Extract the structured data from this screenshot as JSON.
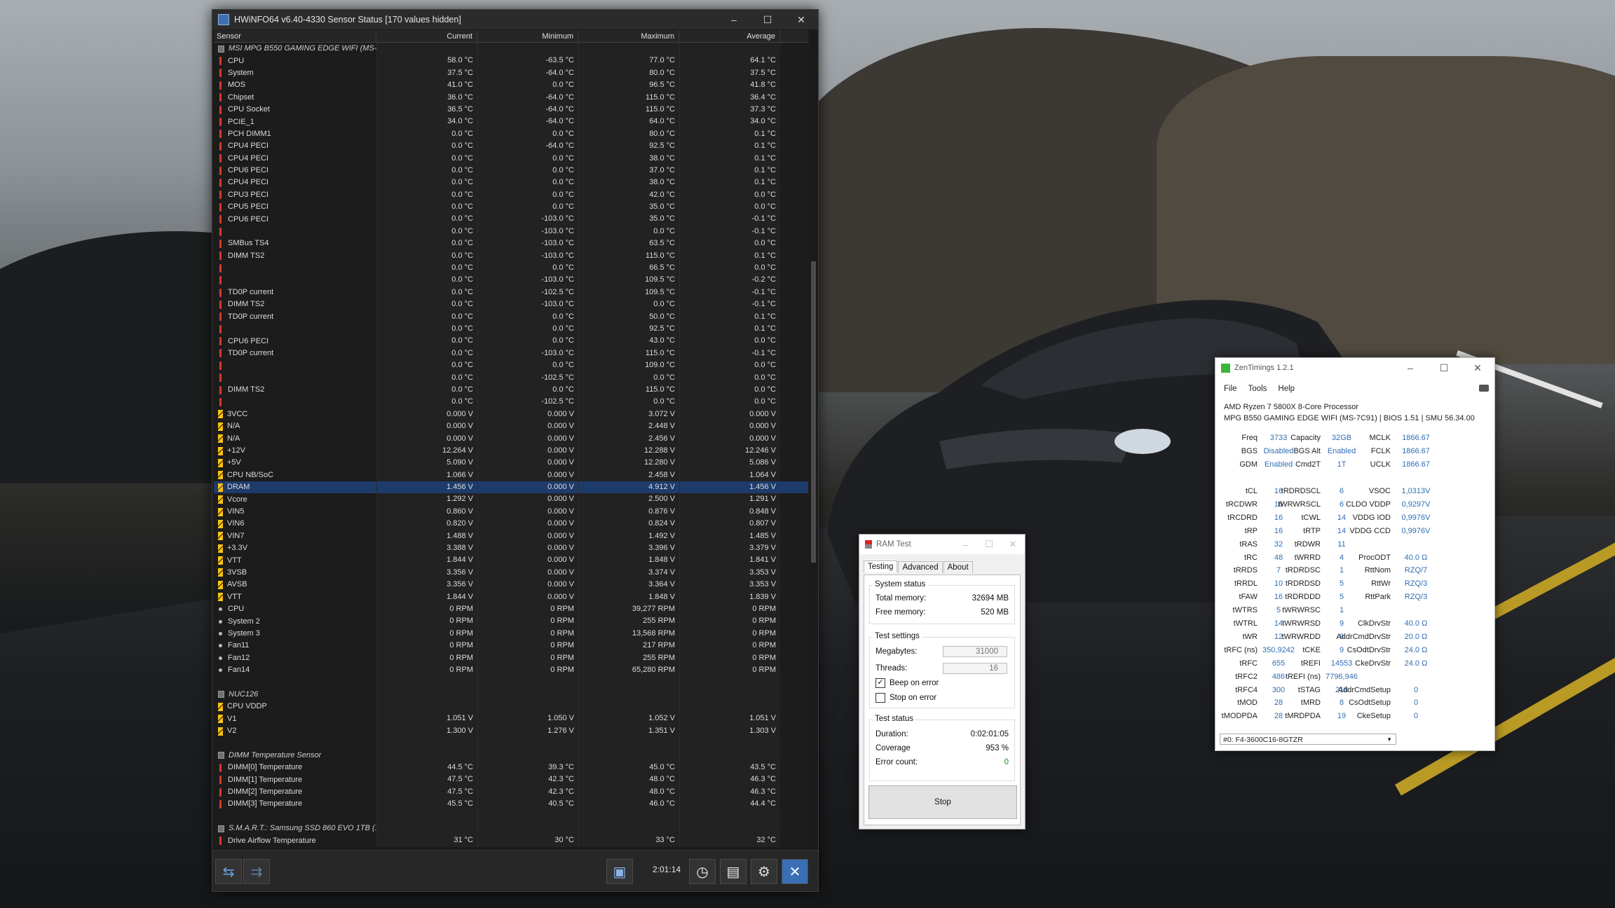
{
  "hwinfo": {
    "title": "HWiNFO64 v6.40-4330 Sensor Status [170 values hidden]",
    "columns": [
      "Sensor",
      "Current",
      "Minimum",
      "Maximum",
      "Average"
    ],
    "rows": [
      {
        "kind": "group",
        "name": "MSI MPG B550 GAMING EDGE WIFI (MS-...",
        "cur": "",
        "min": "",
        "max": "",
        "avg": ""
      },
      {
        "kind": "temp",
        "name": "CPU",
        "cur": "58.0 °C",
        "min": "-63.5 °C",
        "max": "77.0 °C",
        "avg": "64.1 °C"
      },
      {
        "kind": "temp",
        "name": "System",
        "cur": "37.5 °C",
        "min": "-64.0 °C",
        "max": "80.0 °C",
        "avg": "37.5 °C"
      },
      {
        "kind": "temp",
        "name": "MOS",
        "cur": "41.0 °C",
        "min": "0.0 °C",
        "max": "96.5 °C",
        "avg": "41.8 °C"
      },
      {
        "kind": "temp",
        "name": "Chipset",
        "cur": "36.0 °C",
        "min": "-64.0 °C",
        "max": "115.0 °C",
        "avg": "36.4 °C"
      },
      {
        "kind": "temp",
        "name": "CPU Socket",
        "cur": "36.5 °C",
        "min": "-64.0 °C",
        "max": "115.0 °C",
        "avg": "37.3 °C"
      },
      {
        "kind": "temp",
        "name": "PCIE_1",
        "cur": "34.0 °C",
        "min": "-64.0 °C",
        "max": "64.0 °C",
        "avg": "34.0 °C"
      },
      {
        "kind": "temp",
        "name": "PCH DIMM1",
        "cur": "0.0 °C",
        "min": "0.0 °C",
        "max": "80.0 °C",
        "avg": "0.1 °C"
      },
      {
        "kind": "temp",
        "name": "CPU4 PECI",
        "cur": "0.0 °C",
        "min": "-64.0 °C",
        "max": "92.5 °C",
        "avg": "0.1 °C"
      },
      {
        "kind": "temp",
        "name": "CPU4 PECI",
        "cur": "0.0 °C",
        "min": "0.0 °C",
        "max": "38.0 °C",
        "avg": "0.1 °C"
      },
      {
        "kind": "temp",
        "name": "CPU6 PECI",
        "cur": "0.0 °C",
        "min": "0.0 °C",
        "max": "37.0 °C",
        "avg": "0.1 °C"
      },
      {
        "kind": "temp",
        "name": "CPU4 PECI",
        "cur": "0.0 °C",
        "min": "0.0 °C",
        "max": "38.0 °C",
        "avg": "0.1 °C"
      },
      {
        "kind": "temp",
        "name": "CPU3 PECI",
        "cur": "0.0 °C",
        "min": "0.0 °C",
        "max": "42.0 °C",
        "avg": "0.0 °C"
      },
      {
        "kind": "temp",
        "name": "CPU5 PECI",
        "cur": "0.0 °C",
        "min": "0.0 °C",
        "max": "35.0 °C",
        "avg": "0.0 °C"
      },
      {
        "kind": "temp",
        "name": "CPU6 PECI",
        "cur": "0.0 °C",
        "min": "-103.0 °C",
        "max": "35.0 °C",
        "avg": "-0.1 °C"
      },
      {
        "kind": "temp",
        "name": "",
        "cur": "0.0 °C",
        "min": "-103.0 °C",
        "max": "0.0 °C",
        "avg": "-0.1 °C"
      },
      {
        "kind": "temp",
        "name": "SMBus TS4",
        "cur": "0.0 °C",
        "min": "-103.0 °C",
        "max": "63.5 °C",
        "avg": "0.0 °C"
      },
      {
        "kind": "temp",
        "name": "DIMM TS2",
        "cur": "0.0 °C",
        "min": "-103.0 °C",
        "max": "115.0 °C",
        "avg": "0.1 °C"
      },
      {
        "kind": "temp",
        "name": "",
        "cur": "0.0 °C",
        "min": "0.0 °C",
        "max": "66.5 °C",
        "avg": "0.0 °C"
      },
      {
        "kind": "temp",
        "name": "",
        "cur": "0.0 °C",
        "min": "-103.0 °C",
        "max": "109.5 °C",
        "avg": "-0.2 °C"
      },
      {
        "kind": "temp",
        "name": "TD0P current",
        "cur": "0.0 °C",
        "min": "-102.5 °C",
        "max": "109.5 °C",
        "avg": "-0.1 °C"
      },
      {
        "kind": "temp",
        "name": "DIMM TS2",
        "cur": "0.0 °C",
        "min": "-103.0 °C",
        "max": "0.0 °C",
        "avg": "-0.1 °C"
      },
      {
        "kind": "temp",
        "name": "TD0P current",
        "cur": "0.0 °C",
        "min": "0.0 °C",
        "max": "50.0 °C",
        "avg": "0.1 °C"
      },
      {
        "kind": "temp",
        "name": "",
        "cur": "0.0 °C",
        "min": "0.0 °C",
        "max": "92.5 °C",
        "avg": "0.1 °C"
      },
      {
        "kind": "temp",
        "name": "CPU6 PECI",
        "cur": "0.0 °C",
        "min": "0.0 °C",
        "max": "43.0 °C",
        "avg": "0.0 °C"
      },
      {
        "kind": "temp",
        "name": "TD0P current",
        "cur": "0.0 °C",
        "min": "-103.0 °C",
        "max": "115.0 °C",
        "avg": "-0.1 °C"
      },
      {
        "kind": "temp",
        "name": "",
        "cur": "0.0 °C",
        "min": "0.0 °C",
        "max": "109.0 °C",
        "avg": "0.0 °C"
      },
      {
        "kind": "temp",
        "name": "",
        "cur": "0.0 °C",
        "min": "-102.5 °C",
        "max": "0.0 °C",
        "avg": "0.0 °C"
      },
      {
        "kind": "temp",
        "name": "DIMM TS2",
        "cur": "0.0 °C",
        "min": "0.0 °C",
        "max": "115.0 °C",
        "avg": "0.0 °C"
      },
      {
        "kind": "temp",
        "name": "",
        "cur": "0.0 °C",
        "min": "-102.5 °C",
        "max": "0.0 °C",
        "avg": "0.0 °C"
      },
      {
        "kind": "volt",
        "name": "3VCC",
        "cur": "0.000 V",
        "min": "0.000 V",
        "max": "3.072 V",
        "avg": "0.000 V"
      },
      {
        "kind": "volt",
        "name": "N/A",
        "cur": "0.000 V",
        "min": "0.000 V",
        "max": "2.448 V",
        "avg": "0.000 V"
      },
      {
        "kind": "volt",
        "name": "N/A",
        "cur": "0.000 V",
        "min": "0.000 V",
        "max": "2.456 V",
        "avg": "0.000 V"
      },
      {
        "kind": "volt",
        "name": "+12V",
        "cur": "12.264 V",
        "min": "0.000 V",
        "max": "12.288 V",
        "avg": "12.246 V"
      },
      {
        "kind": "volt",
        "name": "+5V",
        "cur": "5.090 V",
        "min": "0.000 V",
        "max": "12.280 V",
        "avg": "5.086 V"
      },
      {
        "kind": "volt",
        "name": "CPU NB/SoC",
        "cur": "1.066 V",
        "min": "0.000 V",
        "max": "2.458 V",
        "avg": "1.064 V"
      },
      {
        "kind": "volt",
        "name": "DRAM",
        "cur": "1.456 V",
        "min": "0.000 V",
        "max": "4.912 V",
        "avg": "1.456 V",
        "selected": true
      },
      {
        "kind": "volt",
        "name": "Vcore",
        "cur": "1.292 V",
        "min": "0.000 V",
        "max": "2.500 V",
        "avg": "1.291 V"
      },
      {
        "kind": "volt",
        "name": "VIN5",
        "cur": "0.860 V",
        "min": "0.000 V",
        "max": "0.876 V",
        "avg": "0.848 V"
      },
      {
        "kind": "volt",
        "name": "VIN6",
        "cur": "0.820 V",
        "min": "0.000 V",
        "max": "0.824 V",
        "avg": "0.807 V"
      },
      {
        "kind": "volt",
        "name": "VIN7",
        "cur": "1.488 V",
        "min": "0.000 V",
        "max": "1.492 V",
        "avg": "1.485 V"
      },
      {
        "kind": "volt",
        "name": "+3.3V",
        "cur": "3.388 V",
        "min": "0.000 V",
        "max": "3.396 V",
        "avg": "3.379 V"
      },
      {
        "kind": "volt",
        "name": "VTT",
        "cur": "1.844 V",
        "min": "0.000 V",
        "max": "1.848 V",
        "avg": "1.841 V"
      },
      {
        "kind": "volt",
        "name": "3VSB",
        "cur": "3.356 V",
        "min": "0.000 V",
        "max": "3.374 V",
        "avg": "3.353 V"
      },
      {
        "kind": "volt",
        "name": "AVSB",
        "cur": "3.356 V",
        "min": "0.000 V",
        "max": "3.364 V",
        "avg": "3.353 V"
      },
      {
        "kind": "volt",
        "name": "VTT",
        "cur": "1.844 V",
        "min": "0.000 V",
        "max": "1.848 V",
        "avg": "1.839 V"
      },
      {
        "kind": "fan",
        "name": "CPU",
        "cur": "0 RPM",
        "min": "0 RPM",
        "max": "39,277 RPM",
        "avg": "0 RPM"
      },
      {
        "kind": "fan",
        "name": "System 2",
        "cur": "0 RPM",
        "min": "0 RPM",
        "max": "255 RPM",
        "avg": "0 RPM"
      },
      {
        "kind": "fan",
        "name": "System 3",
        "cur": "0 RPM",
        "min": "0 RPM",
        "max": "13,568 RPM",
        "avg": "0 RPM"
      },
      {
        "kind": "fan",
        "name": "Fan11",
        "cur": "0 RPM",
        "min": "0 RPM",
        "max": "217 RPM",
        "avg": "0 RPM"
      },
      {
        "kind": "fan",
        "name": "Fan12",
        "cur": "0 RPM",
        "min": "0 RPM",
        "max": "255 RPM",
        "avg": "0 RPM"
      },
      {
        "kind": "fan",
        "name": "Fan14",
        "cur": "0 RPM",
        "min": "0 RPM",
        "max": "65,280 RPM",
        "avg": "0 RPM"
      },
      {
        "kind": "blank",
        "name": "",
        "cur": "",
        "min": "",
        "max": "",
        "avg": ""
      },
      {
        "kind": "group",
        "name": "NUC126",
        "cur": "",
        "min": "",
        "max": "",
        "avg": ""
      },
      {
        "kind": "volt",
        "name": "CPU VDDP",
        "cur": "",
        "min": "",
        "max": "",
        "avg": ""
      },
      {
        "kind": "volt",
        "name": "V1",
        "cur": "1.051 V",
        "min": "1.050 V",
        "max": "1.052 V",
        "avg": "1.051 V"
      },
      {
        "kind": "volt",
        "name": "V2",
        "cur": "1.300 V",
        "min": "1.276 V",
        "max": "1.351 V",
        "avg": "1.303 V"
      },
      {
        "kind": "blank",
        "name": "",
        "cur": "",
        "min": "",
        "max": "",
        "avg": ""
      },
      {
        "kind": "group",
        "name": "DIMM Temperature Sensor",
        "cur": "",
        "min": "",
        "max": "",
        "avg": ""
      },
      {
        "kind": "temp",
        "name": "DIMM[0] Temperature",
        "cur": "44.5 °C",
        "min": "39.3 °C",
        "max": "45.0 °C",
        "avg": "43.5 °C"
      },
      {
        "kind": "temp",
        "name": "DIMM[1] Temperature",
        "cur": "47.5 °C",
        "min": "42.3 °C",
        "max": "48.0 °C",
        "avg": "46.3 °C"
      },
      {
        "kind": "temp",
        "name": "DIMM[2] Temperature",
        "cur": "47.5 °C",
        "min": "42.3 °C",
        "max": "48.0 °C",
        "avg": "46.3 °C"
      },
      {
        "kind": "temp",
        "name": "DIMM[3] Temperature",
        "cur": "45.5 °C",
        "min": "40.5 °C",
        "max": "46.0 °C",
        "avg": "44.4 °C"
      },
      {
        "kind": "blank",
        "name": "",
        "cur": "",
        "min": "",
        "max": "",
        "avg": ""
      },
      {
        "kind": "group",
        "name": "S.M.A.R.T.: Samsung SSD 860 EVO 1TB (...",
        "cur": "",
        "min": "",
        "max": "",
        "avg": ""
      },
      {
        "kind": "temp",
        "name": "Drive Airflow Temperature",
        "cur": "31 °C",
        "min": "30 °C",
        "max": "33 °C",
        "avg": "32 °C"
      }
    ],
    "toolbar": {
      "timer": "2:01:14"
    }
  },
  "ramtest": {
    "title": "RAM Test",
    "tabs": [
      "Testing",
      "Advanced",
      "About"
    ],
    "system_status_label": "System status",
    "total_memory_label": "Total memory:",
    "total_memory": "32694 MB",
    "free_memory_label": "Free memory:",
    "free_memory": "520 MB",
    "test_settings_label": "Test settings",
    "megabytes_label": "Megabytes:",
    "megabytes": "31000",
    "threads_label": "Threads:",
    "threads": "16",
    "beep_on_error": "Beep on error",
    "stop_on_error": "Stop on error",
    "test_status_label": "Test status",
    "duration_label": "Duration:",
    "duration": "0:02:01:05",
    "coverage_label": "Coverage",
    "coverage": "953 %",
    "error_count_label": "Error count:",
    "error_count": "0",
    "stop_label": "Stop"
  },
  "zentimings": {
    "title": "ZenTimings 1.2.1",
    "menu": [
      "File",
      "Tools",
      "Help"
    ],
    "cpu": "AMD Ryzen 7 5800X 8-Core Processor",
    "board": "MPG B550 GAMING EDGE WIFI (MS-7C91) | BIOS 1.51 | SMU 56.34.00",
    "top": [
      [
        "Freq",
        "3733",
        "Capacity",
        "32GB",
        "MCLK",
        "1866.67"
      ],
      [
        "BGS",
        "Disabled",
        "BGS Alt",
        "Enabled",
        "FCLK",
        "1866.67"
      ],
      [
        "GDM",
        "Enabled",
        "Cmd2T",
        "1T",
        "UCLK",
        "1866.67"
      ]
    ],
    "timings": [
      [
        "tCL",
        "16",
        "tRDRDSCL",
        "6",
        "VSOC",
        "1,0313V"
      ],
      [
        "tRCDWR",
        "16",
        "tWRWRSCL",
        "6",
        "CLDO VDDP",
        "0,9297V"
      ],
      [
        "tRCDRD",
        "16",
        "tCWL",
        "14",
        "VDDG IOD",
        "0,9976V"
      ],
      [
        "tRP",
        "16",
        "tRTP",
        "14",
        "VDDG CCD",
        "0,9976V"
      ],
      [
        "tRAS",
        "32",
        "tRDWR",
        "11",
        "",
        ""
      ],
      [
        "tRC",
        "48",
        "tWRRD",
        "4",
        "ProcODT",
        "40.0 Ω"
      ],
      [
        "tRRDS",
        "7",
        "tRDRDSC",
        "1",
        "RttNom",
        "RZQ/7"
      ],
      [
        "tRRDL",
        "10",
        "tRDRDSD",
        "5",
        "RttWr",
        "RZQ/3"
      ],
      [
        "tFAW",
        "16",
        "tRDRDDD",
        "5",
        "RttPark",
        "RZQ/3"
      ],
      [
        "tWTRS",
        "5",
        "tWRWRSC",
        "1",
        "",
        ""
      ],
      [
        "tWTRL",
        "14",
        "tWRWRSD",
        "9",
        "ClkDrvStr",
        "40.0 Ω"
      ],
      [
        "tWR",
        "12",
        "tWRWRDD",
        "9",
        "AddrCmdDrvStr",
        "20.0 Ω"
      ],
      [
        "tRFC (ns)",
        "350,9242",
        "tCKE",
        "9",
        "CsOdtDrvStr",
        "24.0 Ω"
      ],
      [
        "tRFC",
        "655",
        "tREFI",
        "14553",
        "CkeDrvStr",
        "24.0 Ω"
      ],
      [
        "tRFC2",
        "486",
        "tREFI (ns)",
        "7796,946",
        "",
        ""
      ],
      [
        "tRFC4",
        "300",
        "tSTAG",
        "218",
        "AddrCmdSetup",
        "0"
      ],
      [
        "tMOD",
        "28",
        "tMRD",
        "8",
        "CsOdtSetup",
        "0"
      ],
      [
        "tMODPDA",
        "28",
        "tMRDPDA",
        "19",
        "CkeSetup",
        "0"
      ]
    ],
    "dimm_select": "#0: F4-3600C16-8GTZR"
  }
}
